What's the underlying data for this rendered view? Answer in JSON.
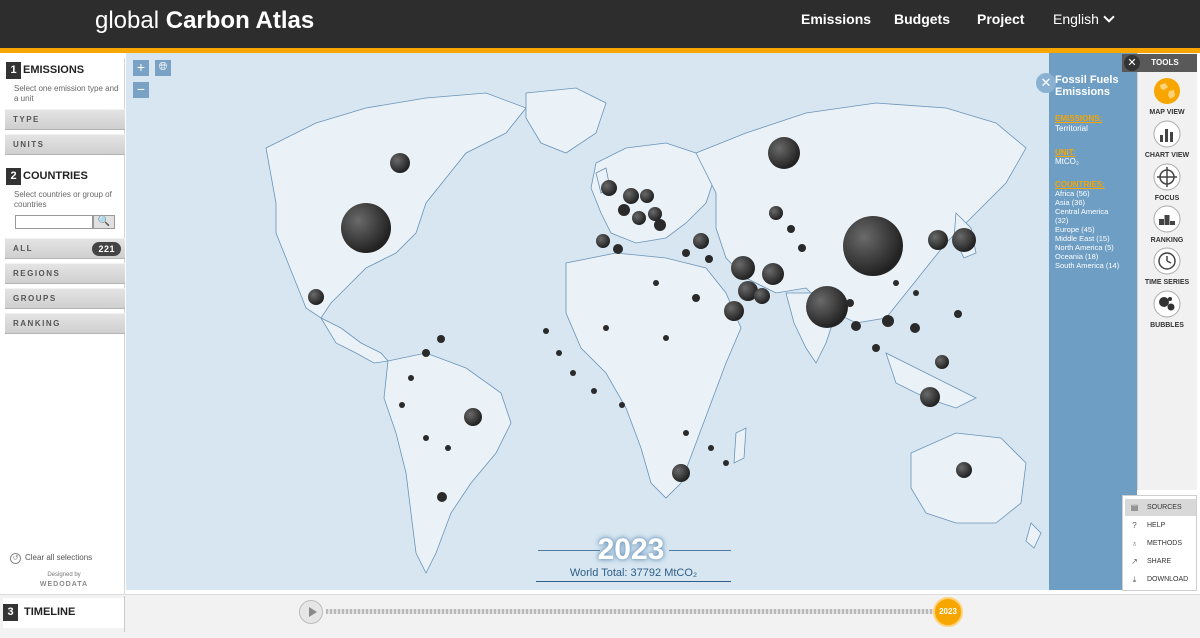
{
  "header": {
    "logo_thin": "global",
    "logo_bold": "Carbon Atlas",
    "nav": [
      "Emissions",
      "Budgets",
      "Project"
    ],
    "language": "English"
  },
  "colors": {
    "accent": "#f7a600",
    "header_bg": "#2d2d2d",
    "map_ocean": "#d7e6f0",
    "map_land": "#eaf2f8",
    "info_panel": "#6e9ec4",
    "bubble": "#2f2f2f"
  },
  "left_panel": {
    "emissions": {
      "num": "1",
      "title": "EMISSIONS",
      "desc": "Select one emission type and a unit",
      "items": [
        "TYPE",
        "UNITS"
      ]
    },
    "countries": {
      "num": "2",
      "title": "COUNTRIES",
      "desc": "Select countries or group of countries",
      "search_btn": "🔍"
    },
    "list": {
      "all_label": "ALL",
      "all_count": "221",
      "items": [
        "REGIONS",
        "GROUPS",
        "RANKING"
      ]
    },
    "clear": "Clear all selections",
    "designed_by": "Designed by",
    "brand": "WEDODATA"
  },
  "map": {
    "zoom_in": "+",
    "zoom_out": "−",
    "globe": "globe-icon",
    "year": "2023",
    "world_total": "World Total: 37792 MtCO₂"
  },
  "info": {
    "close": "✕",
    "title": "Fossil Fuels Emissions",
    "emissions_label": "EMISSIONS:",
    "emissions_value": "Territorial",
    "unit_label": "UNIT:",
    "unit_value": "MtCO₂",
    "countries_label": "COUNTRIES:",
    "countries": [
      "Africa (56)",
      "Asia (36)",
      "Central America",
      "(32)",
      "Europe (45)",
      "Middle East (15)",
      "North America (5)",
      "Oceania (18)",
      "South America (14)"
    ]
  },
  "tools": {
    "title": "TOOLS",
    "close": "✕",
    "items": [
      "MAP VIEW",
      "CHART VIEW",
      "FOCUS",
      "RANKING",
      "TIME SERIES",
      "BUBBLES"
    ]
  },
  "side_menu": [
    "SOURCES",
    "HELP",
    "METHODS",
    "SHARE",
    "DOWNLOAD"
  ],
  "timeline": {
    "num": "3",
    "title": "TIMELINE",
    "year": "2023"
  }
}
